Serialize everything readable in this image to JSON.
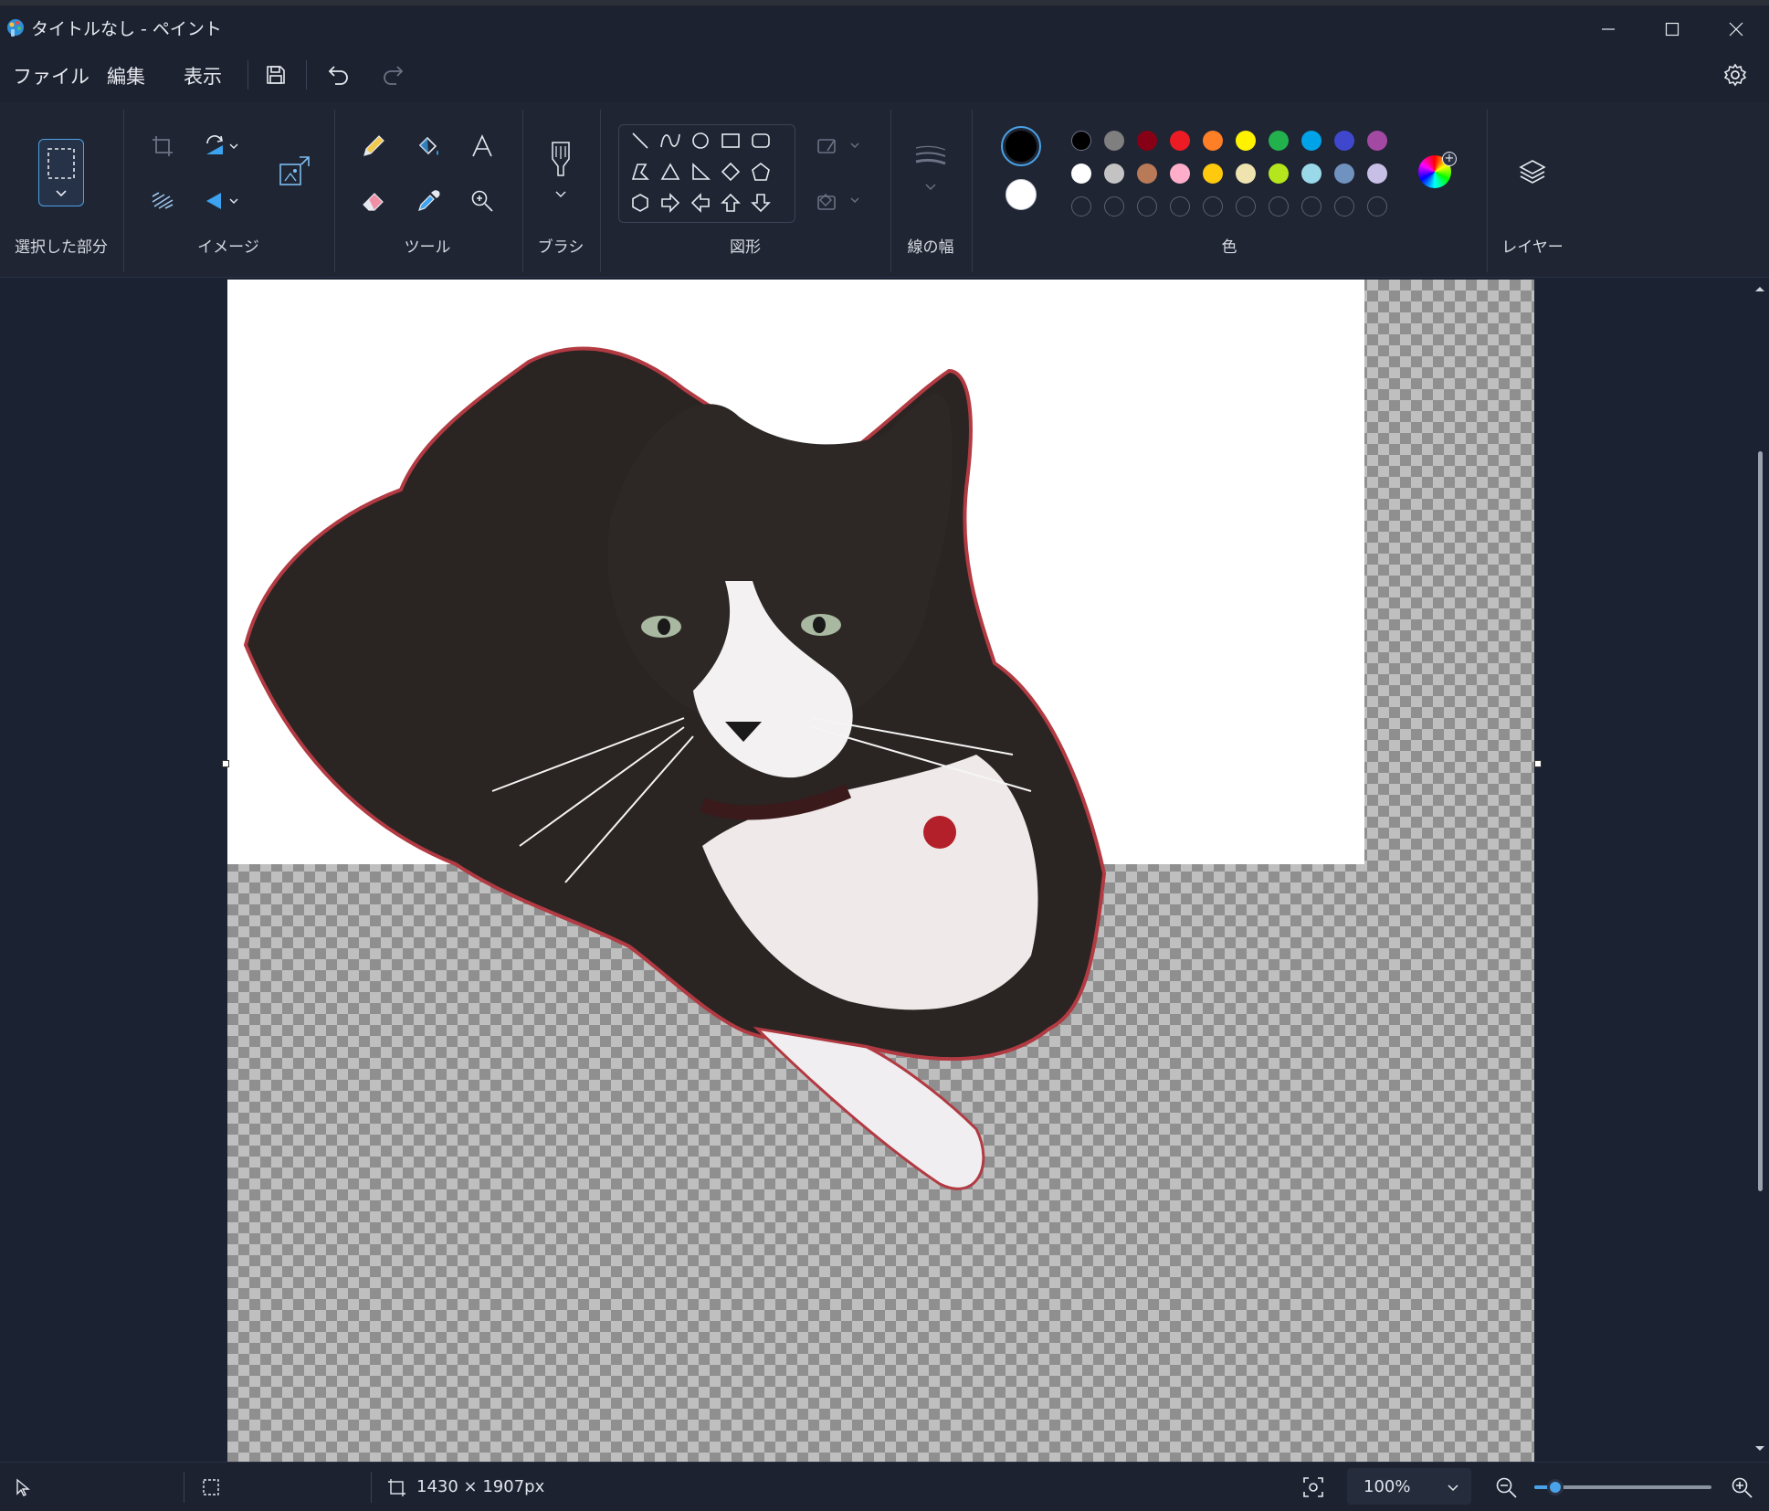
{
  "window": {
    "title": "タイトルなし - ペイント"
  },
  "menu": {
    "file": "ファイル",
    "edit": "編集",
    "view": "表示"
  },
  "ribbon": {
    "groups": {
      "selection": "選択した部分",
      "image": "イメージ",
      "tools": "ツール",
      "brushes": "ブラシ",
      "shapes": "図形",
      "size": "線の幅",
      "colors": "色",
      "layers": "レイヤー"
    },
    "primary_color": "#000000",
    "secondary_color": "#ffffff",
    "palette_row1": [
      "#000000",
      "#7f7f7f",
      "#880015",
      "#ed1c24",
      "#ff7f27",
      "#fff200",
      "#22b14c",
      "#00a2e8",
      "#3f48cc",
      "#a349a4"
    ],
    "palette_row2": [
      "#ffffff",
      "#c3c3c3",
      "#b97a57",
      "#ffaec9",
      "#ffc90e",
      "#efe4b0",
      "#b5e61d",
      "#99d9ea",
      "#7092be",
      "#c8bfe7"
    ],
    "palette_row3_empty_count": 10
  },
  "canvas": {
    "image_subject": "tuxedo cat photo (black and white cat with red collar and bell)"
  },
  "status": {
    "canvas_size": "1430 × 1907px",
    "zoom": "100%",
    "zoom_fraction": 0.12
  }
}
